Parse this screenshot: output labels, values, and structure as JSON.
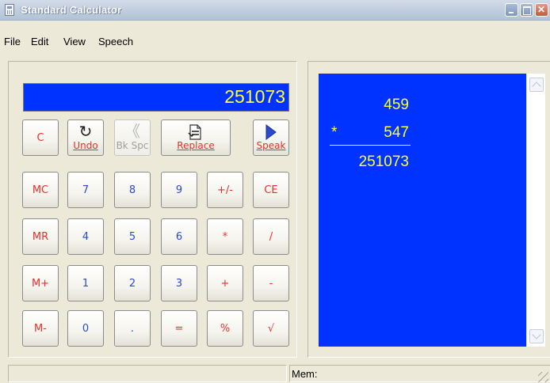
{
  "window": {
    "title": "Standard Calculator"
  },
  "menu": {
    "file": "File",
    "edit": "Edit",
    "view": "View",
    "speech": "Speech"
  },
  "display": {
    "value": "251073"
  },
  "buttons": {
    "clear": "C",
    "undo": "Undo",
    "backspace": "Bk Spc",
    "replace": "Replace",
    "speak": "Speak",
    "mc": "MC",
    "mr": "MR",
    "mplus": "M+",
    "mminus": "M-",
    "ce": "CE",
    "d7": "7",
    "d8": "8",
    "d9": "9",
    "d4": "4",
    "d5": "5",
    "d6": "6",
    "d1": "1",
    "d2": "2",
    "d3": "3",
    "d0": "0",
    "dot": ".",
    "sign": "+/-",
    "multiply": "*",
    "divide": "/",
    "add": "+",
    "subtract": "-",
    "equals": "=",
    "percent": "%",
    "sqrt": "√"
  },
  "icons": {
    "undo": "undo-arrow-icon",
    "backspace": "backspace-chevron-icon",
    "replace": "replace-document-icon",
    "speak": "play-triangle-icon"
  },
  "tape": {
    "operand1": "459",
    "operator": "*",
    "operand2": "547",
    "result": "251073"
  },
  "status": {
    "memory": "Mem:"
  },
  "colors": {
    "display_bg": "#0033ff",
    "display_text": "#ffff33",
    "red_keys": "#e8302a",
    "blue_keys": "#2a4bd0"
  }
}
